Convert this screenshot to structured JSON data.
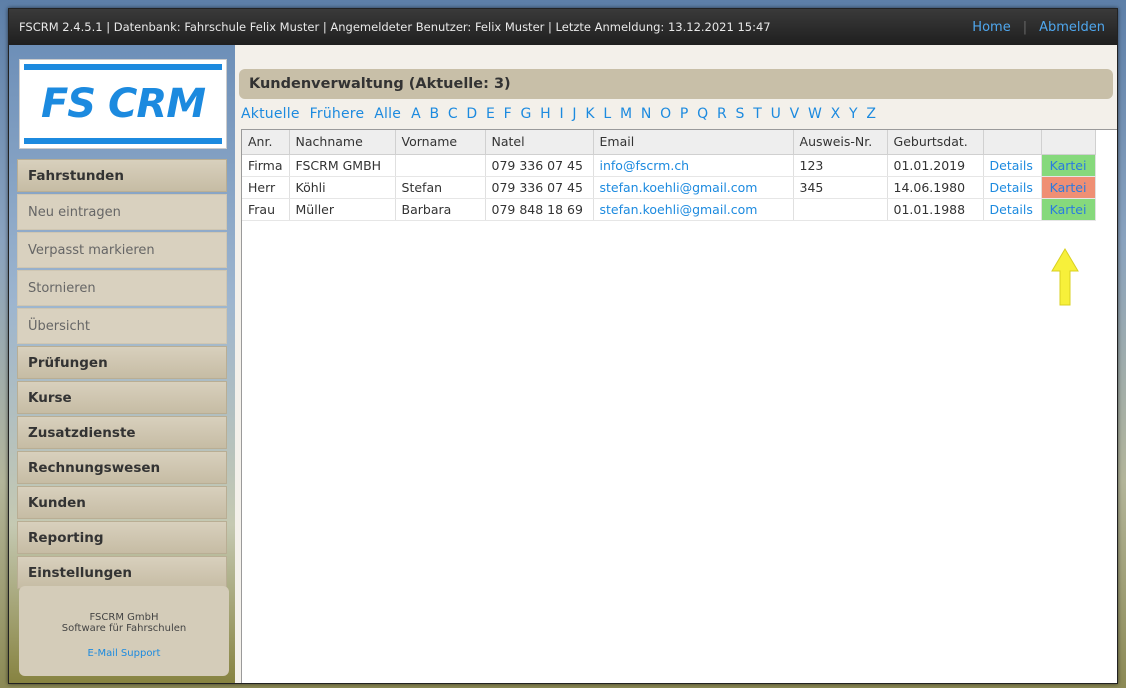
{
  "topbar": {
    "info": "FSCRM 2.4.5.1 | Datenbank: Fahrschule Felix Muster | Angemeldeter Benutzer: Felix Muster | Letzte Anmeldung: 13.12.2021 15:47",
    "home": "Home",
    "logout": "Abmelden"
  },
  "logo": {
    "text": "FS CRM"
  },
  "sidebar": {
    "items": [
      {
        "label": "Fahrstunden",
        "type": "head"
      },
      {
        "label": "Neu eintragen",
        "type": "sub"
      },
      {
        "label": "Verpasst markieren",
        "type": "sub"
      },
      {
        "label": "Stornieren",
        "type": "sub"
      },
      {
        "label": "Übersicht",
        "type": "sub"
      },
      {
        "label": "Prüfungen",
        "type": "head"
      },
      {
        "label": "Kurse",
        "type": "head"
      },
      {
        "label": "Zusatzdienste",
        "type": "head"
      },
      {
        "label": "Rechnungswesen",
        "type": "head"
      },
      {
        "label": "Kunden",
        "type": "head"
      },
      {
        "label": "Reporting",
        "type": "head"
      },
      {
        "label": "Einstellungen",
        "type": "head"
      }
    ]
  },
  "footer": {
    "company": "FSCRM GmbH",
    "tagline": "Software für Fahrschulen",
    "support": "E-Mail Support"
  },
  "main": {
    "title": "Kundenverwaltung (Aktuelle: 3)",
    "filters": [
      "Aktuelle",
      "Frühere",
      "Alle"
    ],
    "letters": [
      "A",
      "B",
      "C",
      "D",
      "E",
      "F",
      "G",
      "H",
      "I",
      "J",
      "K",
      "L",
      "M",
      "N",
      "O",
      "P",
      "Q",
      "R",
      "S",
      "T",
      "U",
      "V",
      "W",
      "X",
      "Y",
      "Z"
    ]
  },
  "table": {
    "headers": [
      "Anr.",
      "Nachname",
      "Vorname",
      "Natel",
      "Email",
      "Ausweis-Nr.",
      "Geburtsdat.",
      "",
      ""
    ],
    "rows": [
      {
        "anr": "Firma",
        "nachname": "FSCRM GMBH",
        "vorname": "",
        "natel": "079 336 07 45",
        "email": "info@fscrm.ch",
        "ausweis": "123",
        "geburtsdat": "01.01.2019",
        "details": "Details",
        "kartei": "Kartei",
        "kartei_color": "#86d97c"
      },
      {
        "anr": "Herr",
        "nachname": "Köhli",
        "vorname": "Stefan",
        "natel": "079 336 07 45",
        "email": "stefan.koehli@gmail.com",
        "ausweis": "345",
        "geburtsdat": "14.06.1980",
        "details": "Details",
        "kartei": "Kartei",
        "kartei_color": "#ef8f74"
      },
      {
        "anr": "Frau",
        "nachname": "Müller",
        "vorname": "Barbara",
        "natel": "079 848 18 69",
        "email": "stefan.koehli@gmail.com",
        "ausweis": "",
        "geburtsdat": "01.01.1988",
        "details": "Details",
        "kartei": "Kartei",
        "kartei_color": "#86d97c"
      }
    ]
  },
  "colors": {
    "accent": "#1c8adf",
    "arrow": "#f7f03a"
  }
}
